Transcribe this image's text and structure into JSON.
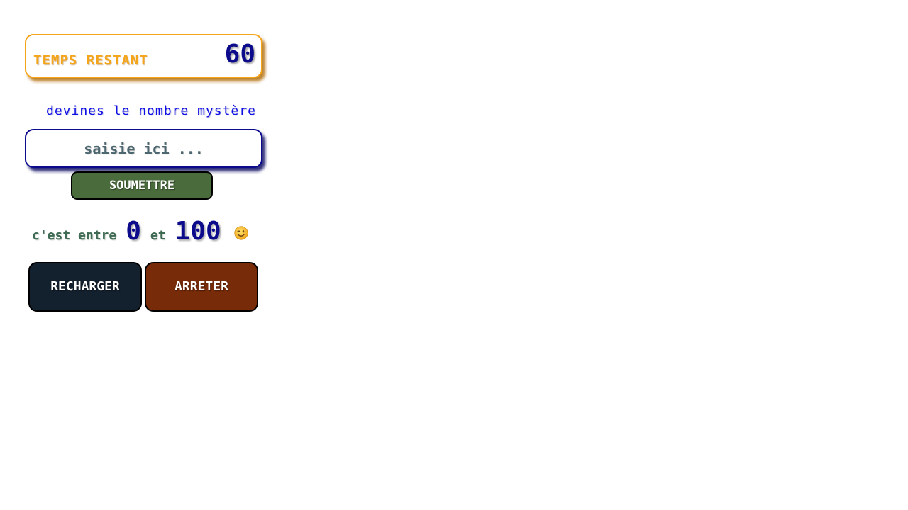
{
  "timer": {
    "label": "TEMPS RESTANT",
    "value": "60",
    "border_color": "#f5a51a",
    "value_color": "#0b0b8c"
  },
  "prompt": {
    "text": "devines le nombre mystère"
  },
  "guess_input": {
    "value": "",
    "placeholder": "saisie ici ..."
  },
  "submit": {
    "label": "SOUMETTRE",
    "color": "#4a6b3c"
  },
  "range": {
    "prefix": "c'est entre",
    "min": "0",
    "connector": "et",
    "max": "100",
    "emoji_icon": "winking-face-icon"
  },
  "actions": {
    "reload_label": "RECHARGER",
    "reload_color": "#13202e",
    "stop_label": "ARRETER",
    "stop_color": "#772b08"
  }
}
